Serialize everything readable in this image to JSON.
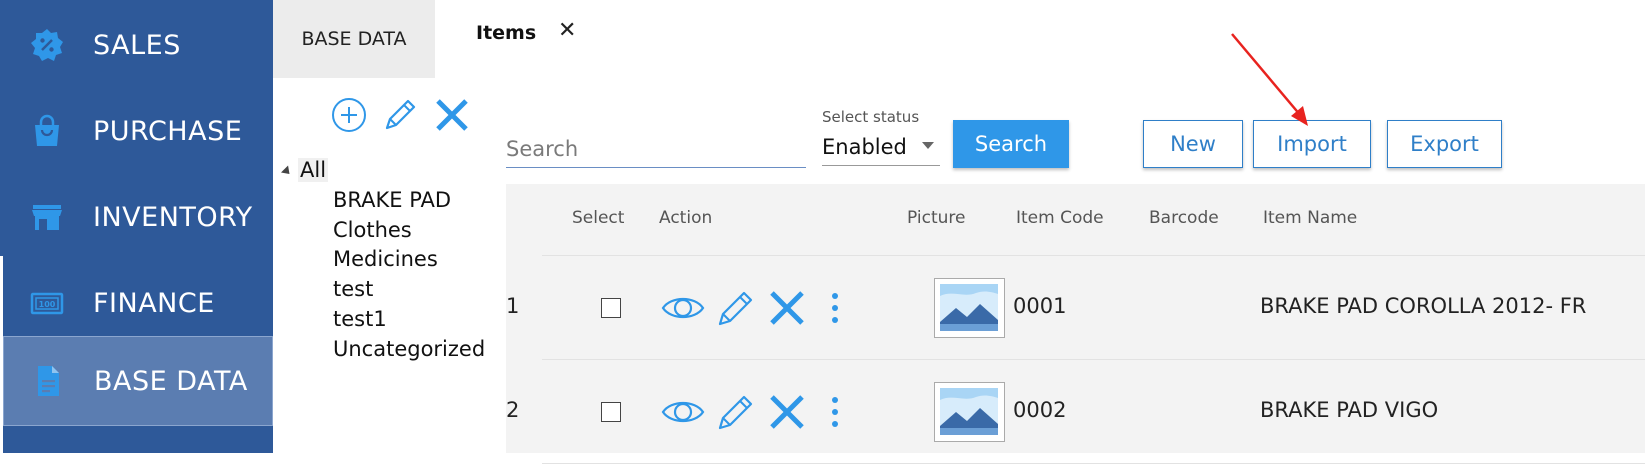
{
  "sidebar": {
    "items": [
      {
        "label": "SALES",
        "icon": "sales-badge-icon"
      },
      {
        "label": "PURCHASE",
        "icon": "shopping-bag-icon"
      },
      {
        "label": "INVENTORY",
        "icon": "store-icon"
      },
      {
        "label": "FINANCE",
        "icon": "money-icon"
      },
      {
        "label": "BASE DATA",
        "icon": "document-icon",
        "active": true
      }
    ]
  },
  "tabs": {
    "base_label": "BASE DATA",
    "items_label": "Items",
    "close_glyph": "✕"
  },
  "tree": {
    "tools": [
      "add-circle-icon",
      "edit-icon",
      "delete-icon"
    ],
    "root": "All",
    "children": [
      "BRAKE PAD",
      "Clothes",
      "Medicines",
      "test",
      "test1",
      "Uncategorized"
    ]
  },
  "toolbar": {
    "search_placeholder": "Search",
    "status_caption": "Select status",
    "status_value": "Enabled",
    "search_button": "Search",
    "new_button": "New",
    "import_button": "Import",
    "export_button": "Export"
  },
  "table": {
    "headers": [
      "Select",
      "Action",
      "Picture",
      "Item Code",
      "Barcode",
      "Item Name"
    ],
    "rows": [
      {
        "num": "1",
        "code": "0001",
        "barcode": "",
        "name": "BRAKE PAD COROLLA 2012- FR"
      },
      {
        "num": "2",
        "code": "0002",
        "barcode": "",
        "name": "BRAKE PAD VIGO"
      }
    ]
  },
  "colors": {
    "sidebar": "#2e5999",
    "sidebar_active": "#5b7db1",
    "accent": "#2f97e8",
    "annotation_arrow": "#e8231f"
  }
}
